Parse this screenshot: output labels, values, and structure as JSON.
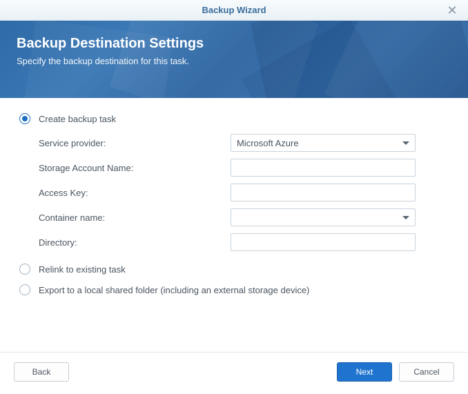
{
  "window": {
    "title": "Backup Wizard"
  },
  "banner": {
    "heading": "Backup Destination Settings",
    "subheading": "Specify the backup destination for this task."
  },
  "options": {
    "create": {
      "label": "Create backup task",
      "selected": true
    },
    "relink": {
      "label": "Relink to existing task",
      "selected": false
    },
    "export": {
      "label": "Export to a local shared folder (including an external storage device)",
      "selected": false
    }
  },
  "form": {
    "service_provider": {
      "label": "Service provider:",
      "value": "Microsoft Azure"
    },
    "storage_account": {
      "label": "Storage Account Name:",
      "value": ""
    },
    "access_key": {
      "label": "Access Key:",
      "value": ""
    },
    "container_name": {
      "label": "Container name:",
      "value": ""
    },
    "directory": {
      "label": "Directory:",
      "value": ""
    }
  },
  "buttons": {
    "back": "Back",
    "next": "Next",
    "cancel": "Cancel"
  }
}
